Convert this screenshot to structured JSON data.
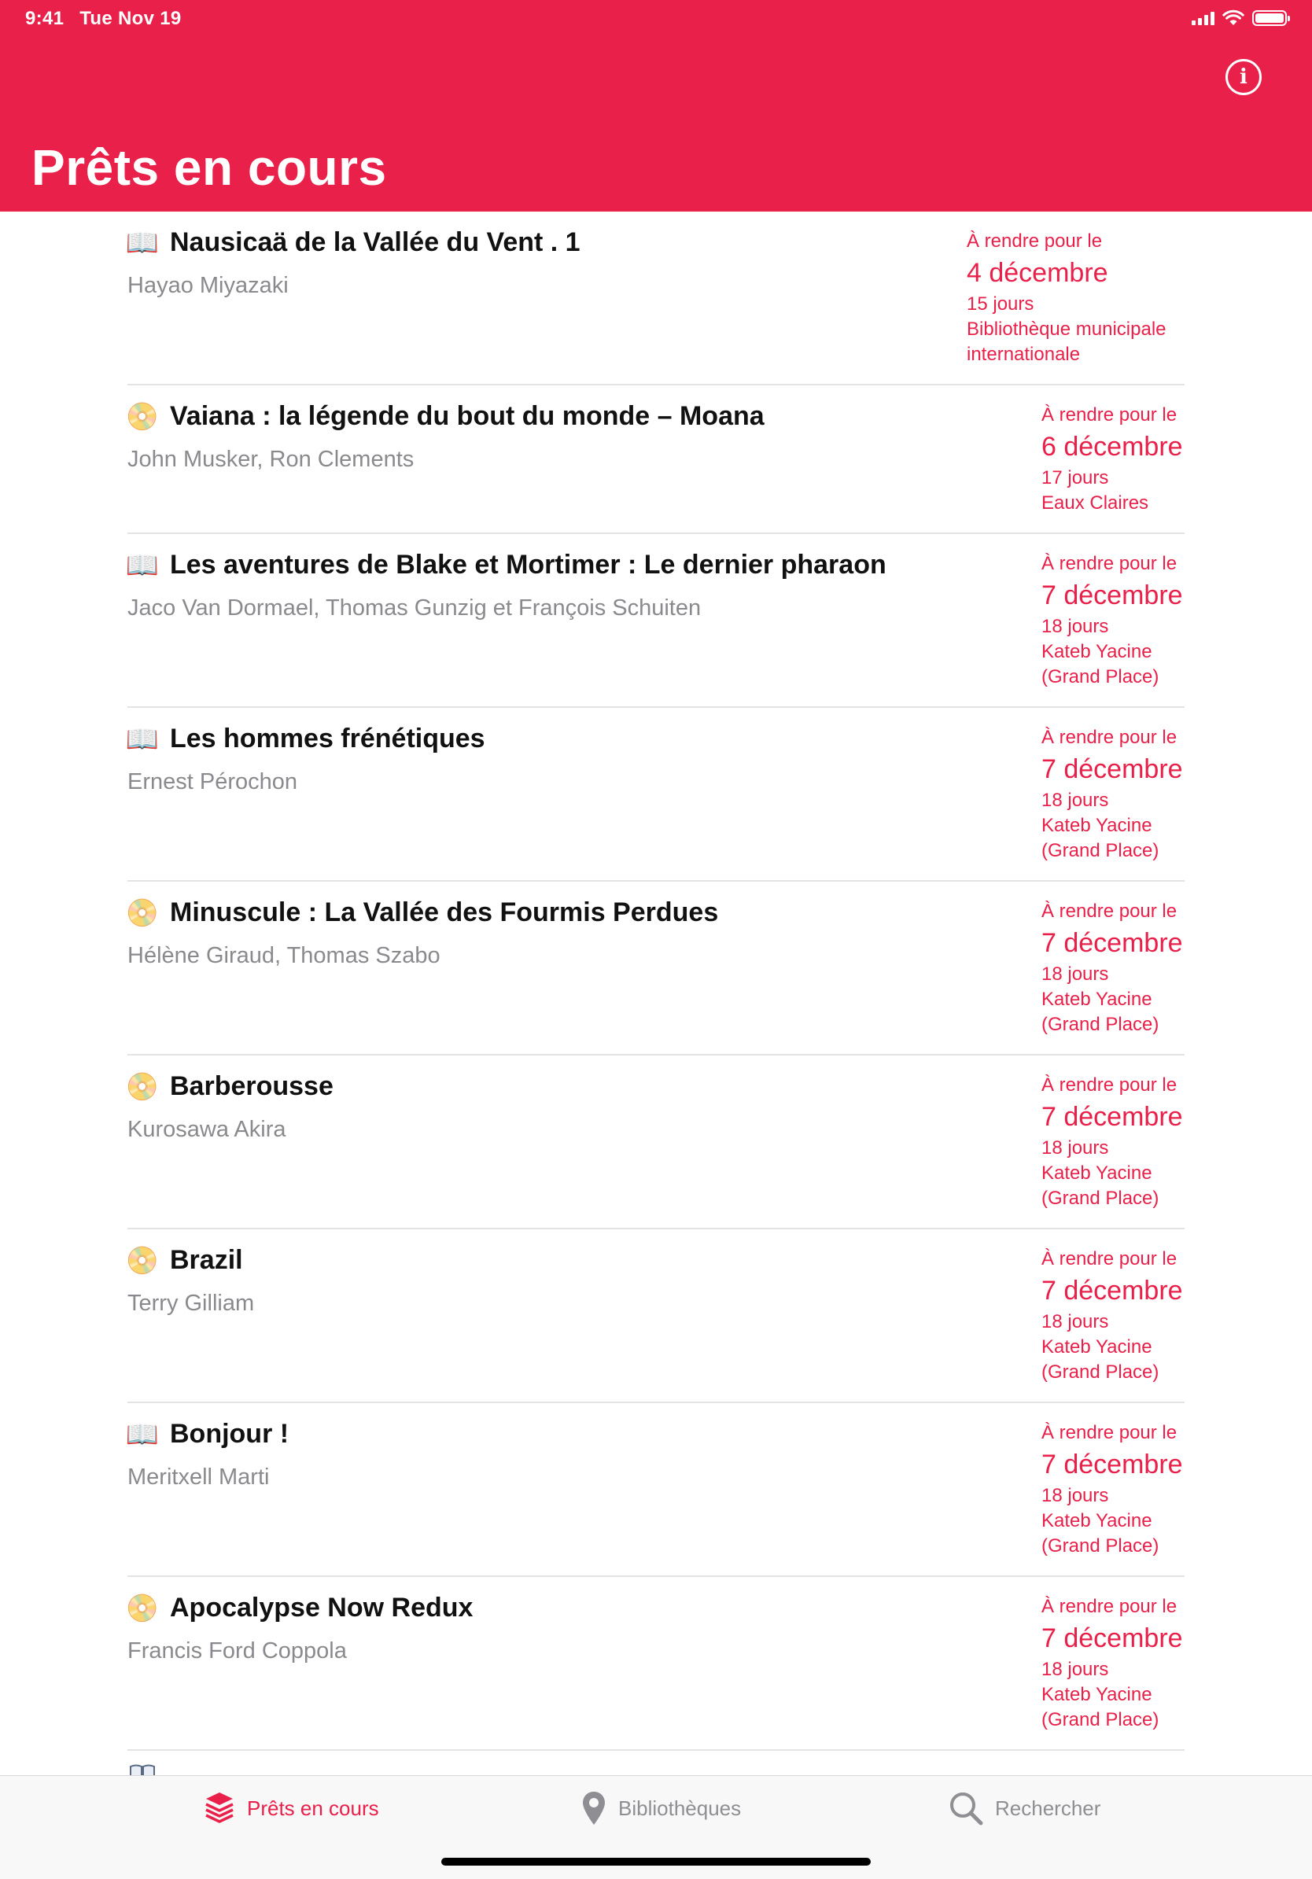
{
  "status_bar": {
    "time": "9:41",
    "date": "Tue Nov 19"
  },
  "header": {
    "title": "Prêts en cours",
    "info_icon": "info-circle-icon",
    "info_glyph": "i",
    "background_color": "#E8204A"
  },
  "colors": {
    "accent": "#E8204A",
    "author_gray": "#8A8A8E",
    "separator": "#E3E3E3"
  },
  "loans": [
    {
      "type": "book",
      "type_glyph": "📖",
      "title": "Nausicaä de la Vallée du Vent . 1",
      "author": "Hayao Miyazaki",
      "due_label": "À rendre pour le",
      "due_date": "4 décembre",
      "days_left": "15 jours",
      "library_line1": "Bibliothèque municipale",
      "library_line2": "internationale"
    },
    {
      "type": "dvd",
      "type_glyph": "📀",
      "title": "Vaiana : la légende du bout du monde – Moana",
      "author": "John Musker, Ron Clements",
      "due_label": "À rendre pour le",
      "due_date": "6 décembre",
      "days_left": "17 jours",
      "library_line1": "Eaux Claires",
      "library_line2": ""
    },
    {
      "type": "book",
      "type_glyph": "📖",
      "title": "Les aventures de Blake et Mortimer : Le dernier pharaon",
      "author": "Jaco Van Dormael, Thomas Gunzig et François Schuiten",
      "due_label": "À rendre pour le",
      "due_date": "7 décembre",
      "days_left": "18 jours",
      "library_line1": "Kateb Yacine",
      "library_line2": "(Grand Place)"
    },
    {
      "type": "book",
      "type_glyph": "📖",
      "title": "Les hommes frénétiques",
      "author": "Ernest Pérochon",
      "due_label": "À rendre pour le",
      "due_date": "7 décembre",
      "days_left": "18 jours",
      "library_line1": "Kateb Yacine",
      "library_line2": "(Grand Place)"
    },
    {
      "type": "dvd",
      "type_glyph": "📀",
      "title": "Minuscule : La Vallée des Fourmis Perdues",
      "author": "Hélène Giraud, Thomas Szabo",
      "due_label": "À rendre pour le",
      "due_date": "7 décembre",
      "days_left": "18 jours",
      "library_line1": "Kateb Yacine",
      "library_line2": "(Grand Place)"
    },
    {
      "type": "dvd",
      "type_glyph": "📀",
      "title": "Barberousse",
      "author": "Kurosawa Akira",
      "due_label": "À rendre pour le",
      "due_date": "7 décembre",
      "days_left": "18 jours",
      "library_line1": "Kateb Yacine",
      "library_line2": "(Grand Place)"
    },
    {
      "type": "dvd",
      "type_glyph": "📀",
      "title": "Brazil",
      "author": "Terry Gilliam",
      "due_label": "À rendre pour le",
      "due_date": "7 décembre",
      "days_left": "18 jours",
      "library_line1": "Kateb Yacine",
      "library_line2": "(Grand Place)"
    },
    {
      "type": "book",
      "type_glyph": "📖",
      "title": "Bonjour !",
      "author": "Meritxell Marti",
      "due_label": "À rendre pour le",
      "due_date": "7 décembre",
      "days_left": "18 jours",
      "library_line1": "Kateb Yacine",
      "library_line2": "(Grand Place)"
    },
    {
      "type": "dvd",
      "type_glyph": "📀",
      "title": "Apocalypse Now Redux",
      "author": "Francis Ford Coppola",
      "due_label": "À rendre pour le",
      "due_date": "7 décembre",
      "days_left": "18 jours",
      "library_line1": "Kateb Yacine",
      "library_line2": "(Grand Place)"
    }
  ],
  "tabbar": {
    "tabs": [
      {
        "label": "Prêts en cours",
        "icon": "stack-books-icon",
        "active": true
      },
      {
        "label": "Bibliothèques",
        "icon": "map-pin-icon",
        "active": false
      },
      {
        "label": "Rechercher",
        "icon": "magnifier-icon",
        "active": false
      }
    ]
  }
}
